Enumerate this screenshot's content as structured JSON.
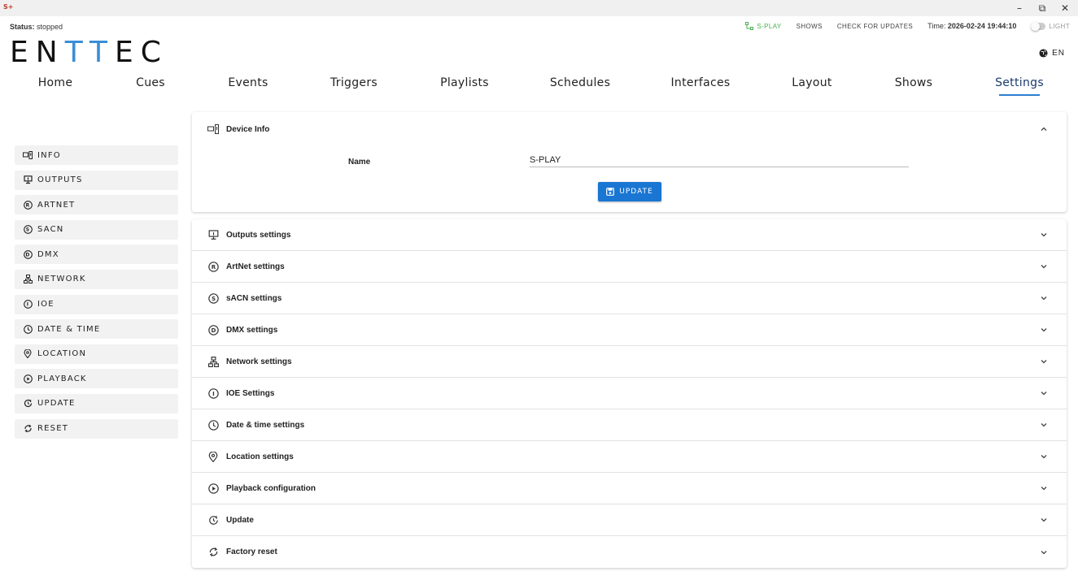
{
  "window": {
    "app_icon": "S+",
    "minimize": "–",
    "restore": "⧉",
    "close": "✕"
  },
  "status": {
    "label": "Status:",
    "value": "stopped"
  },
  "topbar": {
    "device": "S-PLAY",
    "shows": "SHOWS",
    "check_updates": "CHECK FOR UPDATES",
    "time_label": "Time:",
    "time_value": "2026-02-24 19:44:10",
    "theme": "LIGHT"
  },
  "logo": {
    "part1": "EN",
    "part2": "TT",
    "part3": "EC"
  },
  "language": "EN",
  "nav": {
    "tabs": [
      {
        "label": "Home"
      },
      {
        "label": "Cues"
      },
      {
        "label": "Events"
      },
      {
        "label": "Triggers"
      },
      {
        "label": "Playlists"
      },
      {
        "label": "Schedules"
      },
      {
        "label": "Interfaces"
      },
      {
        "label": "Layout"
      },
      {
        "label": "Shows"
      },
      {
        "label": "Settings"
      }
    ],
    "active": "Settings"
  },
  "sidebar": {
    "items": [
      {
        "label": "INFO",
        "icon": "device-icon"
      },
      {
        "label": "OUTPUTS",
        "icon": "outputs-icon"
      },
      {
        "label": "ARTNET",
        "icon": "artnet-icon"
      },
      {
        "label": "SACN",
        "icon": "sacn-icon"
      },
      {
        "label": "DMX",
        "icon": "dmx-icon"
      },
      {
        "label": "NETWORK",
        "icon": "network-icon"
      },
      {
        "label": "IOE",
        "icon": "ioe-icon"
      },
      {
        "label": "DATE & TIME",
        "icon": "clock-icon"
      },
      {
        "label": "LOCATION",
        "icon": "location-icon"
      },
      {
        "label": "PLAYBACK",
        "icon": "play-icon"
      },
      {
        "label": "UPDATE",
        "icon": "update-icon"
      },
      {
        "label": "RESET",
        "icon": "reset-icon"
      }
    ]
  },
  "device_info": {
    "title": "Device Info",
    "name_label": "Name",
    "name_value": "S-PLAY",
    "update_label": "UPDATE"
  },
  "sections": [
    {
      "label": "Outputs settings",
      "icon": "outputs-icon"
    },
    {
      "label": "ArtNet settings",
      "icon": "artnet-icon"
    },
    {
      "label": "sACN settings",
      "icon": "sacn-icon"
    },
    {
      "label": "DMX settings",
      "icon": "dmx-icon"
    },
    {
      "label": "Network settings",
      "icon": "network-icon"
    },
    {
      "label": "IOE Settings",
      "icon": "ioe-icon"
    },
    {
      "label": "Date & time settings",
      "icon": "clock-icon"
    },
    {
      "label": "Location settings",
      "icon": "location-icon"
    },
    {
      "label": "Playback configuration",
      "icon": "play-icon"
    },
    {
      "label": "Update",
      "icon": "update-icon"
    },
    {
      "label": "Factory reset",
      "icon": "reset-icon"
    }
  ],
  "colors": {
    "accent": "#1976d2",
    "logo_accent": "#3a8ed8",
    "device_green": "#4caf50"
  }
}
